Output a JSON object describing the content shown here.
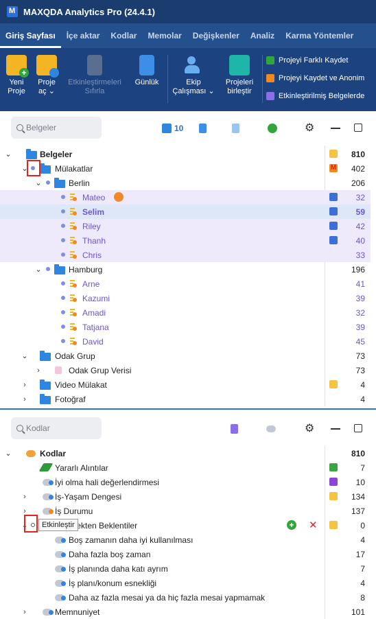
{
  "window": {
    "title": "MAXQDA Analytics Pro (24.4.1)"
  },
  "tabs": [
    "Giriş Sayfası",
    "İçe aktar",
    "Kodlar",
    "Memolar",
    "Değişkenler",
    "Analiz",
    "Karma Yöntemler"
  ],
  "ribbon": {
    "new_project": [
      "Yeni",
      "Proje"
    ],
    "open_project": [
      "Proje",
      "aç ⌄"
    ],
    "reset_activations": [
      "Etkinleştirmeleri",
      "Sıfırla"
    ],
    "logbook": "Günlük",
    "teamwork": [
      "Ekip",
      "Çalışması ⌄"
    ],
    "merge_projects": [
      "Projeleri",
      "birleştir"
    ],
    "save_as": "Projeyi Farklı Kaydet",
    "save_anonymized": "Projeyi Kaydet ve Anonim",
    "activated_docs": "Etkinleştirilmiş Belgelerde"
  },
  "documents": {
    "search_placeholder": "Belgeler",
    "activated_count": "10",
    "rows": [
      {
        "label": "Belgeler",
        "count": "810"
      },
      {
        "label": "Mülakatlar",
        "count": "402"
      },
      {
        "label": "Berlin",
        "count": "206"
      },
      {
        "label": "Mateo",
        "count": "32"
      },
      {
        "label": "Selim",
        "count": "59"
      },
      {
        "label": "Riley",
        "count": "42"
      },
      {
        "label": "Thanh",
        "count": "40"
      },
      {
        "label": "Chris",
        "count": "33"
      },
      {
        "label": "Hamburg",
        "count": "196"
      },
      {
        "label": "Arne",
        "count": "41"
      },
      {
        "label": "Kazumi",
        "count": "39"
      },
      {
        "label": "Amadi",
        "count": "32"
      },
      {
        "label": "Tatjana",
        "count": "39"
      },
      {
        "label": "David",
        "count": "45"
      },
      {
        "label": "Odak Grup",
        "count": "73"
      },
      {
        "label": "Odak Grup Verisi",
        "count": "73"
      },
      {
        "label": "Video Mülakat",
        "count": "4"
      },
      {
        "label": "Fotoğraf",
        "count": "4"
      }
    ]
  },
  "codes": {
    "search_placeholder": "Kodlar",
    "rows": [
      {
        "label": "Kodlar",
        "count": "810"
      },
      {
        "label": "Yararlı Alıntılar",
        "count": "7"
      },
      {
        "label": "İyi olma hali değerlendirmesi",
        "count": "10"
      },
      {
        "label": "İş-Yaşam Dengesi",
        "count": "134"
      },
      {
        "label": "İş Durumu",
        "count": "137"
      },
      {
        "label": "Gelecekten Beklentiler",
        "count": "0"
      },
      {
        "label": "Boş zamanın daha iyi kullanılması",
        "count": "4"
      },
      {
        "label": "Daha fazla boş zaman",
        "count": "17"
      },
      {
        "label": "İş planında daha katı ayrım",
        "count": "7"
      },
      {
        "label": "İş planı/konum esnekliği",
        "count": "4"
      },
      {
        "label": "Daha az fazla mesai ya da hiç fazla mesai yapmamak",
        "count": "8"
      },
      {
        "label": "Memnuniyet",
        "count": "101"
      }
    ],
    "tooltip": "Etkinleştir"
  },
  "colors": {
    "title_bar": "#1a3c6e",
    "ribbon": "#1c4380",
    "accent": "#2f6ed6",
    "selection": "#dde7f8",
    "highlight": "#eeeafc",
    "activated_text": "#6a55d6",
    "annotation_box": "#e3231c"
  }
}
